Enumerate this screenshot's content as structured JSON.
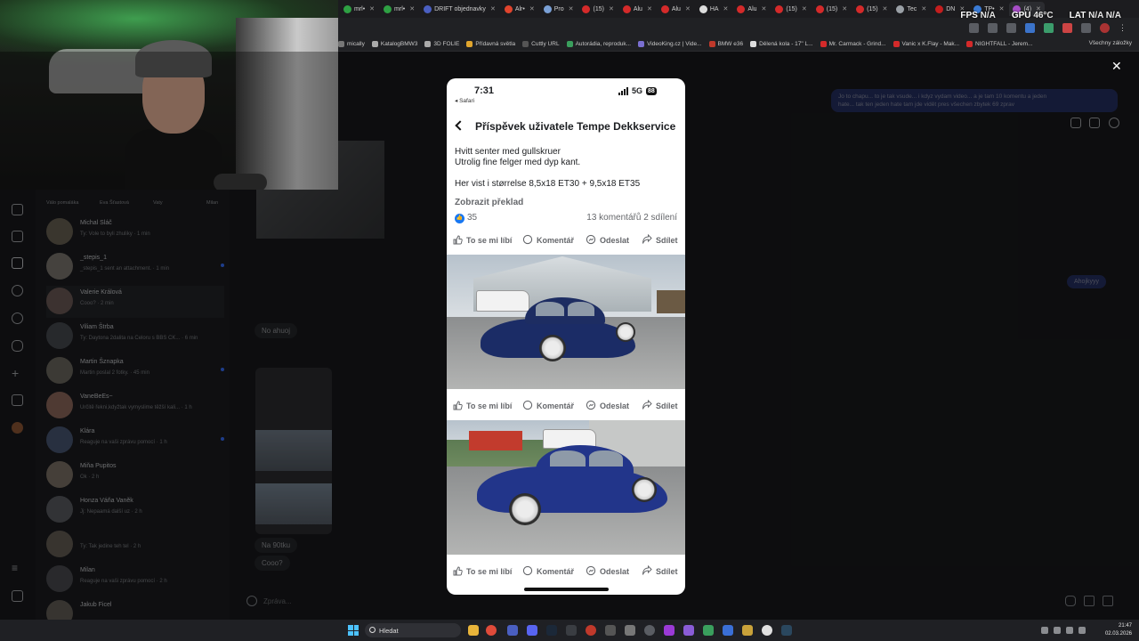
{
  "browser": {
    "tabs": [
      "mrl•",
      "mrl•",
      "DRIFT objednavky",
      "Alr•",
      "Pro",
      "(15)",
      "Alu",
      "Alu",
      "HA",
      "Alu",
      "(15)",
      "(15)",
      "(15)",
      "Tec",
      "DN",
      "TP•",
      "(4)"
    ],
    "tab_colors": [
      "#2ea043",
      "#2ea043",
      "#4a5fc1",
      "#e0442d",
      "#7aa0d6",
      "#d42a2a",
      "#d42a2a",
      "#d42a2a",
      "#dddddd",
      "#d42a2a",
      "#d42a2a",
      "#d42a2a",
      "#d42a2a",
      "#9aa0a6",
      "#c41e1e",
      "#3a7bd5",
      "#a64dc6"
    ],
    "bookmarks": [
      "mically",
      "KatalogBMW3",
      "3D FOLIE",
      "Přídavná světla",
      "Cuttly URL",
      "Autorádia, reproduk...",
      "VideoKing.cz | Vide...",
      "BMW e36",
      "Dělená kola - 17\" L...",
      "Mr. Carmack - Grind...",
      "Vanic x K.Flay - Mak...",
      "NIGHTFALL - Jerem..."
    ],
    "bookmark_colors": [
      "#777777",
      "#aaaaaa",
      "#aaaaaa",
      "#e0a52d",
      "#555555",
      "#3a9f5d",
      "#7a6fd0",
      "#c0392b",
      "#dddddd",
      "#d42a2a",
      "#d42a2a",
      "#d42a2a"
    ],
    "all_bookmarks": "Všechny záložky"
  },
  "overlay": {
    "fps_label": "FPS",
    "fps_value": "N/A",
    "gpu_label": "GPU",
    "gpu_value": "46°C",
    "lat_label": "LAT",
    "lat_value": "N/A N/A"
  },
  "messenger": {
    "stories": [
      "Válo pomaláka",
      "Eva Šťastová",
      "Vaty",
      "Milan"
    ],
    "chats": [
      {
        "name": "Michal Sláč",
        "preview": "Ty: Vole to byli zhuliky · 1 min"
      },
      {
        "name": "_stepis_1",
        "preview": "_stepis_1 sent an attachment. · 1 min"
      },
      {
        "name": "Valerie Králová",
        "preview": "Cooo? · 2 min"
      },
      {
        "name": "Viliam Štrba",
        "preview": "Ty: Daytona 2dalita na Celoru s BBS CK... · 6 min"
      },
      {
        "name": "Martin Šznapka",
        "preview": "Martin poslal 2 fotky. · 45 min"
      },
      {
        "name": "VaneBeEs~",
        "preview": "Určitě řekni,kdyžtak vymyslime těžší kali... · 1 h"
      },
      {
        "name": "Klára",
        "preview": "Reaguje na vaši zprávu pomocí · 1 h"
      },
      {
        "name": "Miňa Pupitos",
        "preview": "Ok · 2 h"
      },
      {
        "name": "Honza Váňa Vaněk",
        "preview": "Jj: Nepaamá další uz · 2 h"
      },
      {
        "name": "",
        "preview": "Ty: Tak jedine teh tel · 2 h"
      },
      {
        "name": "Milan",
        "preview": "Reaguje na vaši zprávu pomocí · 2 h"
      },
      {
        "name": "Jakub Ficel",
        "preview": ""
      }
    ],
    "bubbles_in": [
      "No ahuoj",
      "Na 90tku",
      "Cooo?"
    ],
    "bubbles_out": [
      "Ahojkyyy"
    ],
    "long_out_line1": "Jo to chapu... to je tak vsude... i kdyz vydam video... a je tam 10 komentu a jeden",
    "long_out_line2": "hate... tak ten jeden hate tam jde vidět pres všechen zbytek 69  zprav",
    "composer_placeholder": "Zpráva..."
  },
  "phone": {
    "time": "7:31",
    "back_app": "◂ Safari",
    "network": "5G",
    "battery": "88",
    "header_title": "Příspěvek uživatele Tempe Dekkservice",
    "post_lines": [
      "Hvitt senter med gullskruer",
      "Utrolig fine felger med dyp kant.",
      "",
      "Her vist i størrelse 8,5x18 ET30 + 9,5x18 ET35"
    ],
    "see_translation": "Zobrazit překlad",
    "likes": "35",
    "comments_shares": "13 komentářů  2 sdílení",
    "actions": {
      "like": "To se mi líbí",
      "comment": "Komentář",
      "send": "Odeslat",
      "share": "Sdílet"
    }
  },
  "taskbar": {
    "search_placeholder": "Hledat",
    "time": "21:47",
    "date": "02.03.2026"
  }
}
